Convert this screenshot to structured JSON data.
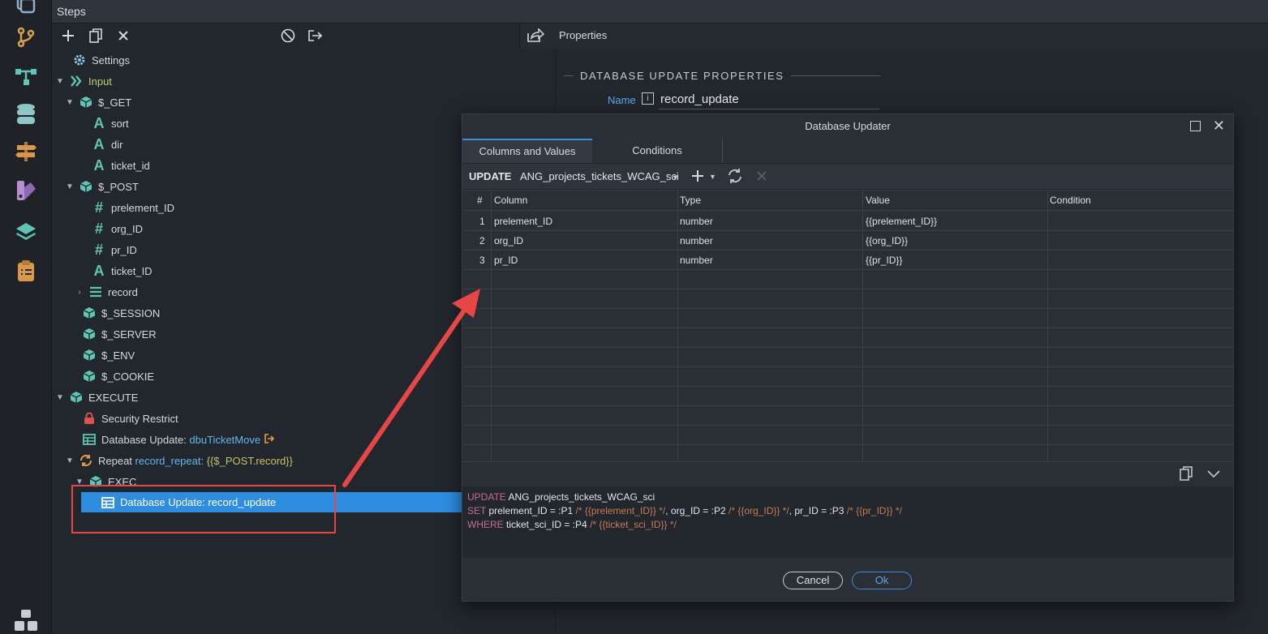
{
  "header": {
    "title": "Steps"
  },
  "properties_panel": {
    "tab_label": "Properties",
    "section_title": "DATABASE UPDATE PROPERTIES",
    "name_label": "Name",
    "name_value": "record_update"
  },
  "tree": {
    "settings": "Settings",
    "input": "Input",
    "get": "$_GET",
    "get_sort": "sort",
    "get_dir": "dir",
    "get_ticket_id": "ticket_id",
    "post": "$_POST",
    "post_prelement": "prelement_ID",
    "post_org": "org_ID",
    "post_pr": "pr_ID",
    "post_ticket": "ticket_ID",
    "post_record": "record",
    "session": "$_SESSION",
    "server": "$_SERVER",
    "env": "$_ENV",
    "cookie": "$_COOKIE",
    "execute": "EXECUTE",
    "security": "Security Restrict",
    "dbu1_prefix": "Database Update: ",
    "dbu1_name": "dbuTicketMove",
    "repeat_prefix": "Repeat ",
    "repeat_name": "record_repeat: ",
    "repeat_expr": "{{$_POST.record}}",
    "exec": "EXEC",
    "dbu2": "Database Update: record_update"
  },
  "dialog": {
    "title": "Database Updater",
    "tabs": [
      "Columns and Values",
      "Conditions"
    ],
    "update_keyword": "UPDATE",
    "table_name": "ANG_projects_tickets_WCAG_sci",
    "columns": [
      "#",
      "Column",
      "Type",
      "Value",
      "Condition"
    ],
    "rows": [
      {
        "n": "1",
        "column": "prelement_ID",
        "type": "number",
        "value": "{{prelement_ID}}",
        "condition": ""
      },
      {
        "n": "2",
        "column": "org_ID",
        "type": "number",
        "value": "{{org_ID}}",
        "condition": ""
      },
      {
        "n": "3",
        "column": "pr_ID",
        "type": "number",
        "value": "{{pr_ID}}",
        "condition": ""
      }
    ],
    "sql": {
      "l1_kw": "UPDATE",
      "l1_rest": " ANG_projects_tickets_WCAG_sci",
      "l2_kw": "SET",
      "l2_a": " prelement_ID = :P1 ",
      "l2_c1": "/* {{prelement_ID}} */",
      "l2_b": ", org_ID = :P2 ",
      "l2_c2": "/* {{org_ID}} */",
      "l2_d": ", pr_ID = :P3 ",
      "l2_c3": "/* {{pr_ID}} */",
      "l3_kw": "WHERE",
      "l3_a": " ticket_sci_ID = :P4 ",
      "l3_c": "/* {{ticket_sci_ID}} */"
    },
    "cancel_label": "Cancel",
    "ok_label": "Ok"
  },
  "colors": {
    "accent": "#2f8de0",
    "annotation": "#e64646",
    "teal_icon": "#5fc6b6"
  }
}
